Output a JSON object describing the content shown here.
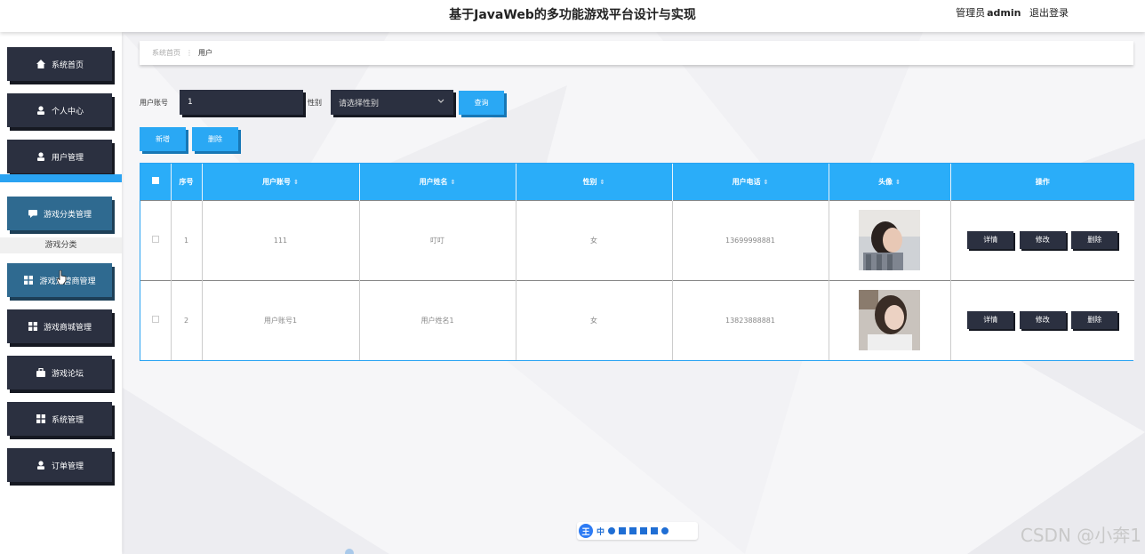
{
  "header": {
    "title": "基于JavaWeb的多功能游戏平台设计与实现",
    "role": "管理员",
    "username": "admin",
    "logout": "退出登录"
  },
  "sidebar": {
    "items": [
      {
        "label": "系统首页",
        "icon": "home-icon"
      },
      {
        "label": "个人中心",
        "icon": "user-icon"
      },
      {
        "label": "用户管理",
        "icon": "user-icon"
      },
      {
        "label": "游戏分类管理",
        "icon": "chat-icon"
      },
      {
        "label": "游戏运营商管理",
        "icon": "grid-icon"
      },
      {
        "label": "游戏商城管理",
        "icon": "grid-icon"
      },
      {
        "label": "游戏论坛",
        "icon": "briefcase-icon"
      },
      {
        "label": "系统管理",
        "icon": "grid-icon"
      },
      {
        "label": "订单管理",
        "icon": "user-icon"
      }
    ],
    "submenu": "游戏分类"
  },
  "breadcrumb": {
    "home": "系统首页",
    "separator": "⋮",
    "current": "用户"
  },
  "search": {
    "account_label": "用户账号",
    "account_value": "1",
    "gender_label": "性别",
    "gender_placeholder": "请选择性别",
    "query": "查询"
  },
  "actions": {
    "add": "新增",
    "delete": "删除"
  },
  "table": {
    "headers": [
      "序号",
      "用户账号",
      "用户姓名",
      "性别",
      "用户电话",
      "头像",
      "操作"
    ],
    "rows": [
      {
        "index": "1",
        "account": "111",
        "name": "叮叮",
        "gender": "女",
        "phone": "13699998881"
      },
      {
        "index": "2",
        "account": "用户账号1",
        "name": "用户姓名1",
        "gender": "女",
        "phone": "13823888881"
      }
    ],
    "row_actions": {
      "detail": "详情",
      "edit": "修改",
      "remove": "删除"
    }
  },
  "ime": {
    "logo": "王",
    "mode": "中"
  },
  "watermark": "CSDN @小奔1",
  "colors": {
    "accent": "#2aa8f4",
    "dark": "#2b3040",
    "active": "#2f6a90"
  }
}
